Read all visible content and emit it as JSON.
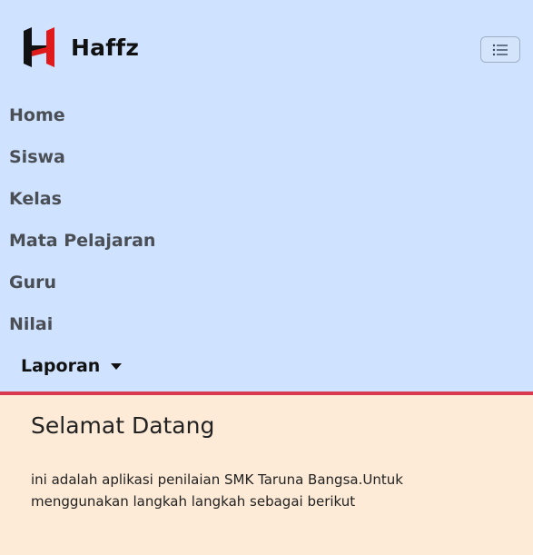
{
  "brand": {
    "name": "Haffz",
    "logo_colors": {
      "black": "#111111",
      "red": "#e01a1a"
    }
  },
  "navbar": {
    "background": "#cfe2ff",
    "toggler_icon": "list-icon",
    "items": [
      {
        "label": "Home"
      },
      {
        "label": "Siswa"
      },
      {
        "label": "Kelas"
      },
      {
        "label": "Mata Pelajaran"
      },
      {
        "label": "Guru"
      },
      {
        "label": "Nilai"
      }
    ],
    "dropdown": {
      "label": "Laporan",
      "icon": "caret-down-icon"
    }
  },
  "accent_color": "#d9394e",
  "main": {
    "title": "Selamat Datang",
    "paragraph": "ini adalah aplikasi penilaian SMK Taruna Bangsa.Untuk menggunakan langkah langkah sebagai berikut"
  }
}
